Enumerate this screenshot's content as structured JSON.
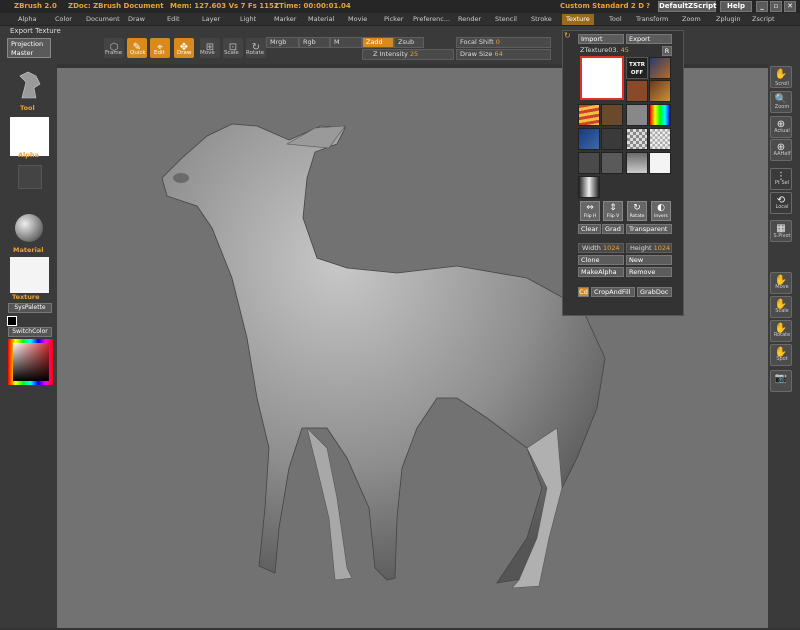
{
  "titlebar": {
    "app": "ZBrush 2.0",
    "doc": "ZDoc: ZBrush Document",
    "mem": "Mem: 127.603  Vs 7  Fs 1151",
    "ztime": "ZTime: 00:00:01.04",
    "ui_menu": "Custom  Standard  2  D",
    "help_q": "?",
    "script": "DefaultZScript",
    "help": "Help",
    "min": "_",
    "max": "▫",
    "close": "✕"
  },
  "menu": [
    "Alpha",
    "Color",
    "Document",
    "Draw",
    "Edit",
    "Layer",
    "Light",
    "Marker",
    "Material",
    "Movie",
    "Picker",
    "Preferenc...",
    "Render",
    "Stencil",
    "Stroke",
    "Texture",
    "Tool",
    "Transform",
    "Zoom",
    "Zplugin",
    "Zscript"
  ],
  "active_menu": "Texture",
  "export_label": "Export Texture",
  "projection_master": "Projection Master",
  "shelf": {
    "frame": "Frame",
    "quick": "Quick",
    "edit": "Edit",
    "draw": "Draw",
    "move": "Move",
    "scale": "Scale",
    "rotate": "Rotate",
    "mrgb": "Mrgb",
    "rgb": "Rgb",
    "m": "M",
    "zadd": "Zadd",
    "zsub": "Zsub",
    "zintensity_label": "Z Intensity",
    "zintensity": "25",
    "focal_label": "Focal Shift",
    "focal": "0",
    "drawsize_label": "Draw Size",
    "drawsize": "64"
  },
  "left": {
    "tool": "Tool",
    "alpha": "Alpha",
    "material": "Material",
    "texture": "Texture",
    "syspalette": "SysPalette",
    "switchcolor": "SwitchColor"
  },
  "right": [
    "Scroll",
    "Zoom",
    "Actual",
    "AAHalf",
    "Pt Sel",
    "Local",
    "S.Pivot",
    "Move",
    "Scale",
    "Rotate",
    "Spot",
    ""
  ],
  "panel": {
    "import": "Import",
    "export": "Export",
    "texture_name": "ZTexture03.",
    "texture_num": "45",
    "r_btn": "R",
    "txtr_off": "TXTR OFF",
    "flipH": "Flip H",
    "flipV": "Flip V",
    "rotate": "Rotate",
    "invers": "Invers",
    "clear": "Clear",
    "grad": "Grad",
    "transparent": "Transparent",
    "width_label": "Width",
    "width": "1024",
    "height_label": "Height",
    "height": "1024",
    "clone": "Clone",
    "new": "New",
    "makealpha": "MakeAlpha",
    "remove": "Remove",
    "cd": "Cd",
    "cropandfill": "CropAndFill",
    "grabdoc": "GrabDoc"
  },
  "colors": {
    "accent": "#d88a1d",
    "bg": "#343434",
    "canvas": "#727272",
    "highlight": "#e0302a"
  }
}
